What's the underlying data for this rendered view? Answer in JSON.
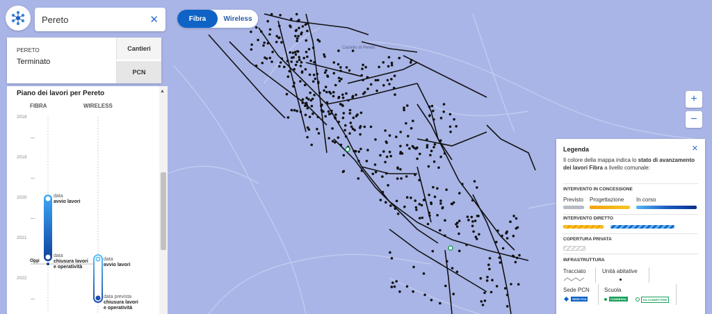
{
  "search": {
    "value": "Pereto"
  },
  "card": {
    "city": "PERETO",
    "status": "Terminato",
    "tab_cantieri": "Cantieri",
    "tab_pcn": "PCN"
  },
  "plan": {
    "title": "Piano dei lavori per Pereto",
    "col_fibra": "FIBRA",
    "col_wireless": "WIRELESS",
    "years": [
      "2018",
      "2019",
      "2020",
      "2021",
      "2022"
    ],
    "today": "Oggi",
    "fibra_start": {
      "label": "data",
      "bold": "avvio lavori"
    },
    "fibra_end": {
      "label": "data",
      "bold1": "chiusura lavori",
      "bold2": "e operatività"
    },
    "wireless_start": {
      "label": "data",
      "bold": "avvio lavori"
    },
    "wireless_end": {
      "label": "data prevista",
      "bold1": "chiusura lavori",
      "bold2": "e operatività"
    }
  },
  "toggle": {
    "fibra": "Fibra",
    "wireless": "Wireless"
  },
  "map": {
    "place_label": "Castello di Pereto"
  },
  "zoom": {
    "in": "+",
    "out": "−"
  },
  "legend": {
    "title": "Legenda",
    "desc_1": "Il colore della mappa indica lo",
    "desc_bold_1": "stato di avanzamento dei lavori Fibra",
    "desc_2": "a livello comunale:",
    "sec_concessione": "INTERVENTO IN CONCESSIONE",
    "lab_previsto": "Previsto",
    "lab_progettazione": "Progettazione",
    "lab_incorso": "In corso",
    "sec_diretto": "INTERVENTO DIRETTO",
    "sec_privata": "COPERTURA PRIVATA",
    "sec_infra": "INFRASTRUTTURA",
    "lab_tracciato": "Tracciato",
    "lab_unita": "Unità abitative",
    "lab_sede": "Sede PCN",
    "lab_scuola": "Scuola",
    "badge_sede": "SEDE PCN",
    "badge_connessa": "CONNESSA",
    "badge_daconnettere": "DA CONNETTERE"
  },
  "colors": {
    "map_bg": "#a9b5e6",
    "fibra_blue": "#0f63c5",
    "accent": "#2d6ecf",
    "network": "#111111",
    "school_green": "#1aa05a"
  }
}
